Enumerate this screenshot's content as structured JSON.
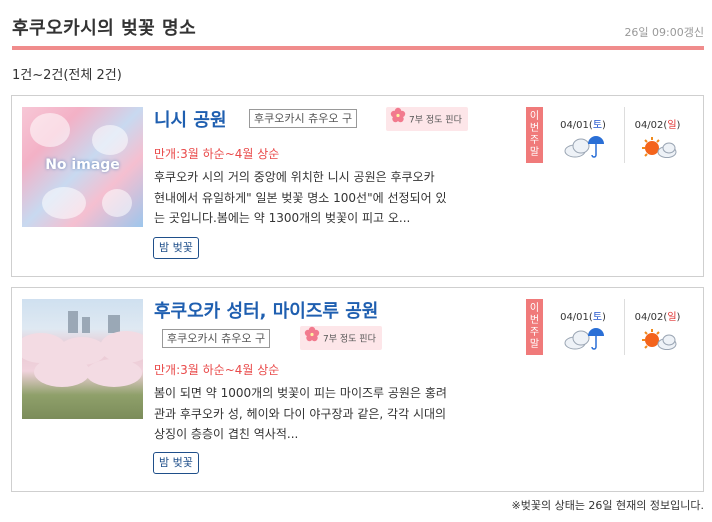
{
  "header": {
    "title": "후쿠오카시의 벚꽃 명소",
    "updated": "26일 09:00갱신"
  },
  "count_text": "1건~2건(전체 2건)",
  "spots": [
    {
      "name": "니시 공원",
      "region": "후쿠오카시 츄우오 구",
      "bloom_status": "7부 정도 핀다",
      "peak": "만개:3월 하순~4월 상순",
      "desc_lines": [
        "후쿠오카 시의 거의 중앙에 위치한 니시 공원은 후쿠오카",
        "현내에서 유일하게\" 일본 벚꽃 명소 100선\"에 선정되어 있",
        "는 곳입니다.봄에는 약 1300개의 벚꽃이 피고 오..."
      ],
      "tag": "밤 벚꽃",
      "thumb_text": "No image",
      "week_label": "이번주말",
      "forecast": [
        {
          "date": "04/01",
          "dow": "토",
          "weather": "cloud-rain-icon"
        },
        {
          "date": "04/02",
          "dow": "일",
          "weather": "sun-cloud-icon"
        }
      ]
    },
    {
      "name": "후쿠오카 성터, 마이즈루 공원",
      "region": "후쿠오카시 츄우오 구",
      "bloom_status": "7부 정도 핀다",
      "peak": "만개:3월 하순~4월 상순",
      "desc_lines": [
        "봄이 되면 약 1000개의 벚꽃이 피는 마이즈루 공원은 홍려",
        "관과 후쿠오카 성, 헤이와 다이 야구장과 같은, 각각 시대의",
        "상징이 층층이 겹친 역사적..."
      ],
      "tag": "밤 벚꽃",
      "week_label": "이번주말",
      "forecast": [
        {
          "date": "04/01",
          "dow": "토",
          "weather": "cloud-rain-icon"
        },
        {
          "date": "04/02",
          "dow": "일",
          "weather": "sun-cloud-icon"
        }
      ]
    }
  ],
  "footnote": "※벚꽃의 상태는 26일 현재의 정보입니다.",
  "colors": {
    "accent_pink": "#f08c8c",
    "title_blue": "#1f5fb0",
    "peak_red": "#e94a4a",
    "sat_blue": "#2255cc",
    "sun_red": "#e03030"
  }
}
